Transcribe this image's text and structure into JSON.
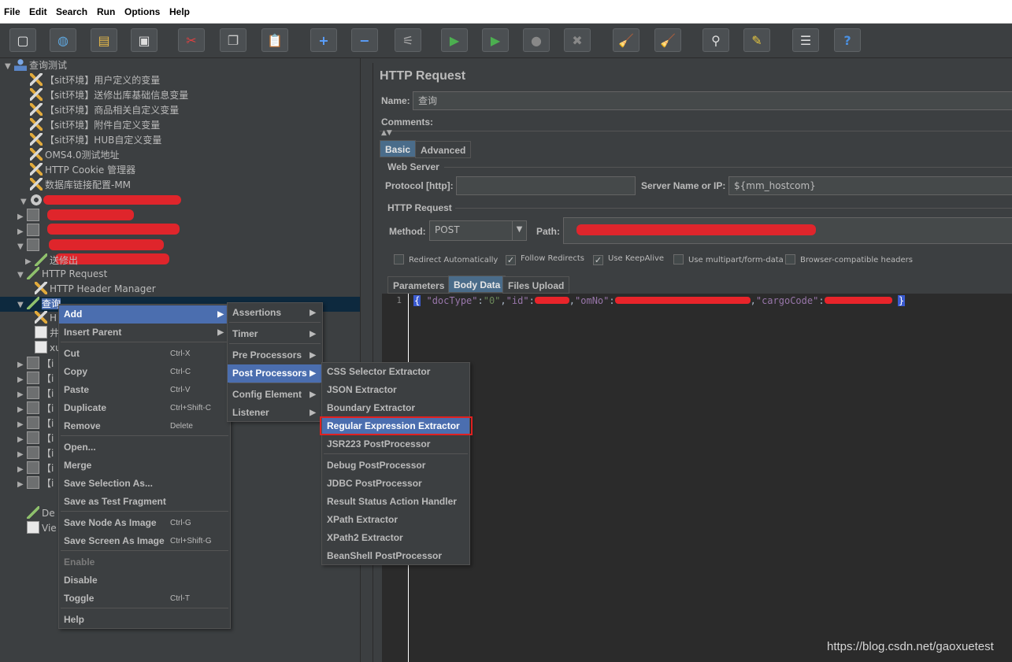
{
  "menubar": [
    "File",
    "Edit",
    "Search",
    "Run",
    "Options",
    "Help"
  ],
  "toolbar": [
    {
      "icon": "new-icon",
      "glyph": "▢"
    },
    {
      "icon": "templates-icon",
      "glyph": "◍"
    },
    {
      "icon": "open-icon",
      "glyph": "▤"
    },
    {
      "icon": "save-icon",
      "glyph": "▣"
    },
    {
      "icon": "cut-icon",
      "glyph": "✂"
    },
    {
      "icon": "copy-icon",
      "glyph": "❐"
    },
    {
      "icon": "paste-icon",
      "glyph": "📋"
    },
    {
      "icon": "expand-icon",
      "glyph": "+"
    },
    {
      "icon": "collapse-icon",
      "glyph": "−"
    },
    {
      "icon": "toggle-icon",
      "glyph": "⚟"
    },
    {
      "icon": "start-icon",
      "glyph": "▶"
    },
    {
      "icon": "start-no-pause-icon",
      "glyph": "▶"
    },
    {
      "icon": "stop-icon",
      "glyph": "●"
    },
    {
      "icon": "shutdown-icon",
      "glyph": "✖"
    },
    {
      "icon": "clear-icon",
      "glyph": "🧹"
    },
    {
      "icon": "clear-all-icon",
      "glyph": "🧹"
    },
    {
      "icon": "search-icon",
      "glyph": "⚲"
    },
    {
      "icon": "reset-search-icon",
      "glyph": "✎"
    },
    {
      "icon": "function-helper-icon",
      "glyph": "☰"
    },
    {
      "icon": "help-icon",
      "glyph": "?"
    }
  ],
  "tree": [
    {
      "label": "查询测试",
      "indent": 0,
      "toggle": "▼",
      "icon": "person"
    },
    {
      "label": "【sit环境】用户定义的变量",
      "indent": 1,
      "toggle": "",
      "icon": "wrench"
    },
    {
      "label": "【sit环境】送修出库基础信息变量",
      "indent": 1,
      "toggle": "",
      "icon": "wrench"
    },
    {
      "label": "【sit环境】商品相关自定义变量",
      "indent": 1,
      "toggle": "",
      "icon": "wrench"
    },
    {
      "label": "【sit环境】附件自定义变量",
      "indent": 1,
      "toggle": "",
      "icon": "wrench"
    },
    {
      "label": "【sit环境】HUB自定义变量",
      "indent": 1,
      "toggle": "",
      "icon": "wrench"
    },
    {
      "label": "OMS4.0测试地址",
      "indent": 1,
      "toggle": "",
      "icon": "wrench"
    },
    {
      "label": "HTTP Cookie 管理器",
      "indent": 1,
      "toggle": "",
      "icon": "wrench"
    },
    {
      "label": "数据库链接配置-MM",
      "indent": 1,
      "toggle": "",
      "icon": "wrench"
    },
    {
      "label": "",
      "indent": 1,
      "toggle": "▼",
      "icon": "gear"
    },
    {
      "label": "",
      "indent": 2,
      "toggle": "▶",
      "icon": "box"
    },
    {
      "label": "",
      "indent": 2,
      "toggle": "▶",
      "icon": "box"
    },
    {
      "label": "",
      "indent": 2,
      "toggle": "▼",
      "icon": "box"
    },
    {
      "label": "送修出",
      "indent": 3,
      "toggle": "▶",
      "icon": "pipette"
    },
    {
      "label": "HTTP Request",
      "indent": 2,
      "toggle": "▼",
      "icon": "pipette"
    },
    {
      "label": "HTTP Header Manager",
      "indent": 3,
      "toggle": "",
      "icon": "wrench"
    },
    {
      "label": "查询",
      "indent": 2,
      "toggle": "▼",
      "icon": "pipette"
    },
    {
      "label": "H",
      "indent": 3,
      "toggle": "",
      "icon": "wrench"
    },
    {
      "label": "井",
      "indent": 3,
      "toggle": "",
      "icon": "doc"
    },
    {
      "label": "xu",
      "indent": 3,
      "toggle": "",
      "icon": "doc"
    },
    {
      "label": "【i",
      "indent": 2,
      "toggle": "▶",
      "icon": "box"
    },
    {
      "label": "【i",
      "indent": 2,
      "toggle": "▶",
      "icon": "box"
    },
    {
      "label": "【i",
      "indent": 2,
      "toggle": "▶",
      "icon": "box"
    },
    {
      "label": "【i",
      "indent": 2,
      "toggle": "▶",
      "icon": "box"
    },
    {
      "label": "【i",
      "indent": 2,
      "toggle": "▶",
      "icon": "box"
    },
    {
      "label": "【i",
      "indent": 2,
      "toggle": "▶",
      "icon": "box"
    },
    {
      "label": "【i",
      "indent": 2,
      "toggle": "▶",
      "icon": "box"
    },
    {
      "label": "【i",
      "indent": 2,
      "toggle": "▶",
      "icon": "box"
    },
    {
      "label": "【i",
      "indent": 2,
      "toggle": "▶",
      "icon": "box"
    },
    {
      "label": "De",
      "indent": 2,
      "toggle": "",
      "icon": "pipette"
    },
    {
      "label": "Vie",
      "indent": 2,
      "toggle": "",
      "icon": "doc"
    }
  ],
  "right": {
    "title": "HTTP Request",
    "name_label": "Name:",
    "name_value": "查询",
    "comments_label": "Comments:",
    "tabs": [
      "Basic",
      "Advanced"
    ],
    "web_server_title": "Web Server",
    "protocol_label": "Protocol [http]:",
    "protocol_value": "",
    "server_label": "Server Name or IP:",
    "server_value": "${mm_hostcom}",
    "http_request_title": "HTTP Request",
    "method_label": "Method:",
    "method_value": "POST",
    "path_label": "Path:",
    "checkboxes": [
      {
        "label": "Redirect Automatically",
        "checked": false
      },
      {
        "label": "Follow Redirects",
        "checked": true
      },
      {
        "label": "Use KeepAlive",
        "checked": true
      },
      {
        "label": "Use multipart/form-data",
        "checked": false
      },
      {
        "label": "Browser-compatible headers",
        "checked": false
      }
    ],
    "body_tabs": [
      "Parameters",
      "Body Data",
      "Files Upload"
    ],
    "line_number": "1",
    "code": {
      "open": "{",
      "k1": "\"docType\"",
      "v1": "\"0\"",
      "k2": "\"id\"",
      "k3": "\"omNo\"",
      "k4": "\"cargoCode\"",
      "close": "}"
    }
  },
  "context_menu": {
    "items": [
      {
        "label": "Add",
        "shortcut": "",
        "arrow": "▶",
        "highlight": true,
        "disabled": false
      },
      {
        "label": "Insert Parent",
        "shortcut": "",
        "arrow": "▶",
        "highlight": false,
        "disabled": false
      },
      {
        "label": "Cut",
        "shortcut": "Ctrl-X",
        "arrow": "",
        "highlight": false,
        "disabled": false
      },
      {
        "label": "Copy",
        "shortcut": "Ctrl-C",
        "arrow": "",
        "highlight": false,
        "disabled": false
      },
      {
        "label": "Paste",
        "shortcut": "Ctrl-V",
        "arrow": "",
        "highlight": false,
        "disabled": false
      },
      {
        "label": "Duplicate",
        "shortcut": "Ctrl+Shift-C",
        "arrow": "",
        "highlight": false,
        "disabled": false
      },
      {
        "label": "Remove",
        "shortcut": "Delete",
        "arrow": "",
        "highlight": false,
        "disabled": false
      },
      {
        "label": "Open...",
        "shortcut": "",
        "arrow": "",
        "highlight": false,
        "disabled": false
      },
      {
        "label": "Merge",
        "shortcut": "",
        "arrow": "",
        "highlight": false,
        "disabled": false
      },
      {
        "label": "Save Selection As...",
        "shortcut": "",
        "arrow": "",
        "highlight": false,
        "disabled": false
      },
      {
        "label": "Save as Test Fragment",
        "shortcut": "",
        "arrow": "",
        "highlight": false,
        "disabled": false
      },
      {
        "label": "Save Node As Image",
        "shortcut": "Ctrl-G",
        "arrow": "",
        "highlight": false,
        "disabled": false
      },
      {
        "label": "Save Screen As Image",
        "shortcut": "Ctrl+Shift-G",
        "arrow": "",
        "highlight": false,
        "disabled": false
      },
      {
        "label": "Enable",
        "shortcut": "",
        "arrow": "",
        "highlight": false,
        "disabled": true
      },
      {
        "label": "Disable",
        "shortcut": "",
        "arrow": "",
        "highlight": false,
        "disabled": false
      },
      {
        "label": "Toggle",
        "shortcut": "Ctrl-T",
        "arrow": "",
        "highlight": false,
        "disabled": false
      },
      {
        "label": "Help",
        "shortcut": "",
        "arrow": "",
        "highlight": false,
        "disabled": false
      }
    ]
  },
  "add_menu": {
    "items": [
      {
        "label": "Assertions",
        "highlight": false
      },
      {
        "label": "Timer",
        "highlight": false
      },
      {
        "label": "Pre Processors",
        "highlight": false
      },
      {
        "label": "Post Processors",
        "highlight": true
      },
      {
        "label": "Config Element",
        "highlight": false
      },
      {
        "label": "Listener",
        "highlight": false
      }
    ]
  },
  "post_menu": {
    "items": [
      {
        "label": "CSS Selector Extractor",
        "highlight": false
      },
      {
        "label": "JSON Extractor",
        "highlight": false
      },
      {
        "label": "Boundary Extractor",
        "highlight": false
      },
      {
        "label": "Regular Expression Extractor",
        "highlight": true
      },
      {
        "label": "JSR223 PostProcessor",
        "highlight": false
      },
      {
        "label": "Debug PostProcessor",
        "highlight": false
      },
      {
        "label": "JDBC PostProcessor",
        "highlight": false
      },
      {
        "label": "Result Status Action Handler",
        "highlight": false
      },
      {
        "label": "XPath Extractor",
        "highlight": false
      },
      {
        "label": "XPath2 Extractor",
        "highlight": false
      },
      {
        "label": "BeanShell PostProcessor",
        "highlight": false
      }
    ]
  },
  "watermark": "https://blog.csdn.net/gaoxuetest"
}
